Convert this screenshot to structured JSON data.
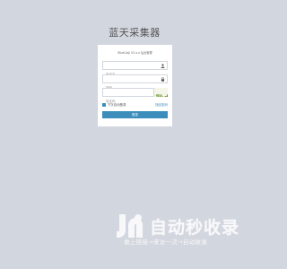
{
  "app": {
    "title": "蓝天采集器"
  },
  "login": {
    "message": "BlueCaiji V2.x.x 后台管理",
    "username_placeholder": "用户名",
    "password_placeholder": "密码",
    "captcha_placeholder": "验证码",
    "captcha_text": "7kdt",
    "remember_label": "下次自动登录",
    "forgot_label": "找回密码",
    "submit_label": "登录"
  },
  "icons": {
    "username": "user-icon",
    "password": "lock-icon"
  },
  "watermark": {
    "brand": "自动秒收录",
    "slogan": "做上链接→来访一次→自动收录"
  },
  "colors": {
    "background": "#d2d6de",
    "accent": "#3c8dbc",
    "panel": "#ffffff"
  }
}
